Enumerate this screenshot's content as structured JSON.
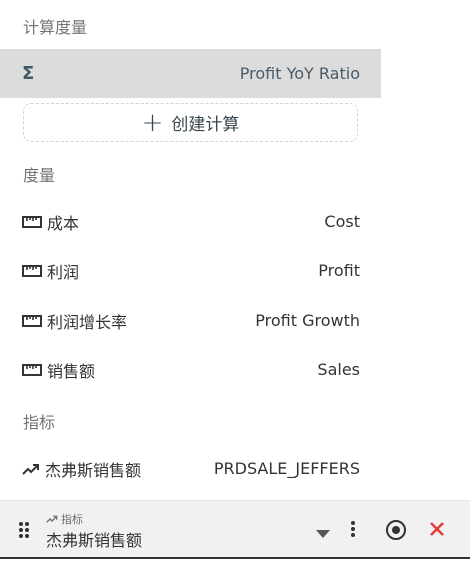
{
  "calc_measures": {
    "title": "计算度量",
    "items": [
      {
        "icon": "sigma-icon",
        "symbol": "Σ",
        "label": "Profit YoY Ratio"
      }
    ],
    "create_button": {
      "icon": "plus-icon",
      "symbol": "+",
      "label": "创建计算"
    }
  },
  "measures": {
    "title": "度量",
    "items": [
      {
        "icon": "ruler-icon",
        "label": "成本",
        "value": "Cost"
      },
      {
        "icon": "ruler-icon",
        "label": "利润",
        "value": "Profit"
      },
      {
        "icon": "ruler-icon",
        "label": "利润增长率",
        "value": "Profit Growth"
      },
      {
        "icon": "ruler-icon",
        "label": "销售额",
        "value": "Sales"
      }
    ]
  },
  "metrics": {
    "title": "指标",
    "items": [
      {
        "icon": "trend-icon",
        "label": "杰弗斯销售额",
        "value": "PRDSALE_JEFFERS"
      }
    ]
  },
  "bottom_bar": {
    "type_label": "指标",
    "name": "杰弗斯销售额",
    "icons": [
      "drag-handle-icon",
      "trend-icon",
      "dropdown-caret-icon",
      "more-vertical-icon",
      "target-icon",
      "close-icon"
    ],
    "colors": {
      "close": "#e53935",
      "text": "#333333"
    }
  },
  "colors": {
    "selected_row": "#dcdcdc",
    "muted": "#757575"
  }
}
